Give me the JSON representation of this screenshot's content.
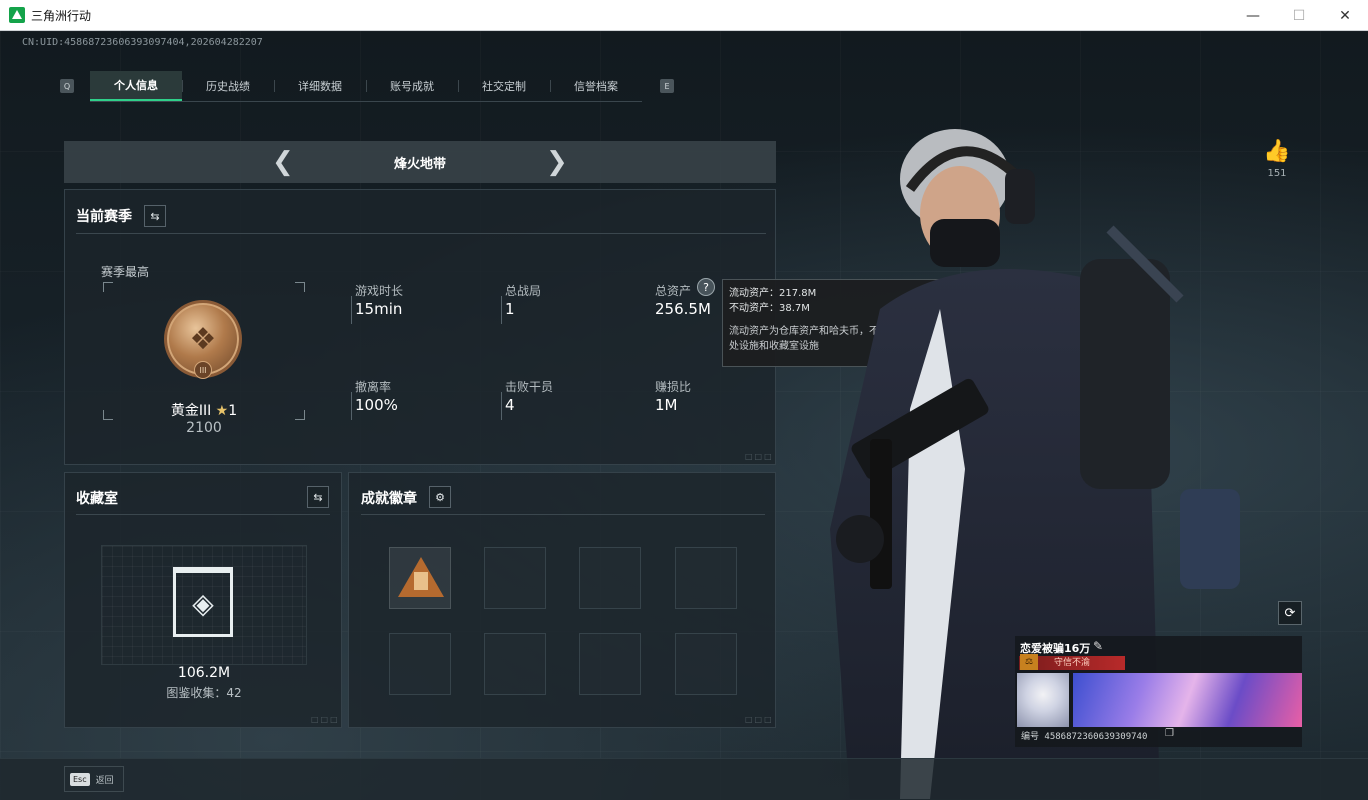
{
  "window": {
    "title": "三角洲行动",
    "minimize_icon": "minimize-icon",
    "maximize_icon": "maximize-icon",
    "close_icon": "close-icon"
  },
  "uid_line": "CN:UID:4586872360639309740​4,202604282207",
  "tabs": {
    "prev_key": "Q",
    "next_key": "E",
    "items": [
      {
        "label": "个人信息",
        "active": true
      },
      {
        "label": "历史战绩",
        "active": false
      },
      {
        "label": "详细数据",
        "active": false
      },
      {
        "label": "账号成就",
        "active": false
      },
      {
        "label": "社交定制",
        "active": false
      },
      {
        "label": "信誉档案",
        "active": false
      }
    ]
  },
  "mode": {
    "title": "烽火地带",
    "prev_icon": "chevron-left-icon",
    "next_icon": "chevron-right-icon"
  },
  "season": {
    "title": "当前赛季",
    "best_label": "赛季最高",
    "rank_name": "黄金III",
    "rank_star": "★",
    "rank_level": "1",
    "rank_score": "2100",
    "rank_numeral": "III",
    "stats": [
      {
        "label": "游戏时长",
        "value": "15min"
      },
      {
        "label": "总战局",
        "value": "1"
      },
      {
        "label": "总资产",
        "value": "256.5M"
      },
      {
        "label": "撤离率",
        "value": "100%"
      },
      {
        "label": "击败干员",
        "value": "4"
      },
      {
        "label": "赚损比",
        "value": "1M"
      }
    ]
  },
  "tooltip": {
    "liquid": "流动资产：217.8M",
    "fixed": "不动资产：38.7M",
    "note": "流动资产为仓库资产和哈夫币，不动资产为特勤处设施和收藏室设施"
  },
  "collection": {
    "title": "收藏室",
    "value": "106.2M",
    "sub": "图鉴收集：42"
  },
  "achievements": {
    "title": "成就徽章"
  },
  "like": {
    "count": "151"
  },
  "player": {
    "name": "恋爱被骗16万",
    "title": "守信不渝",
    "id": "编号 4586872360639309740"
  },
  "footer": {
    "esc_key": "Esc",
    "back_label": "返回"
  },
  "colors": {
    "accent": "#2fd08a",
    "rank_bronze": "#b07a4b",
    "title_red": "#b82a2a"
  }
}
